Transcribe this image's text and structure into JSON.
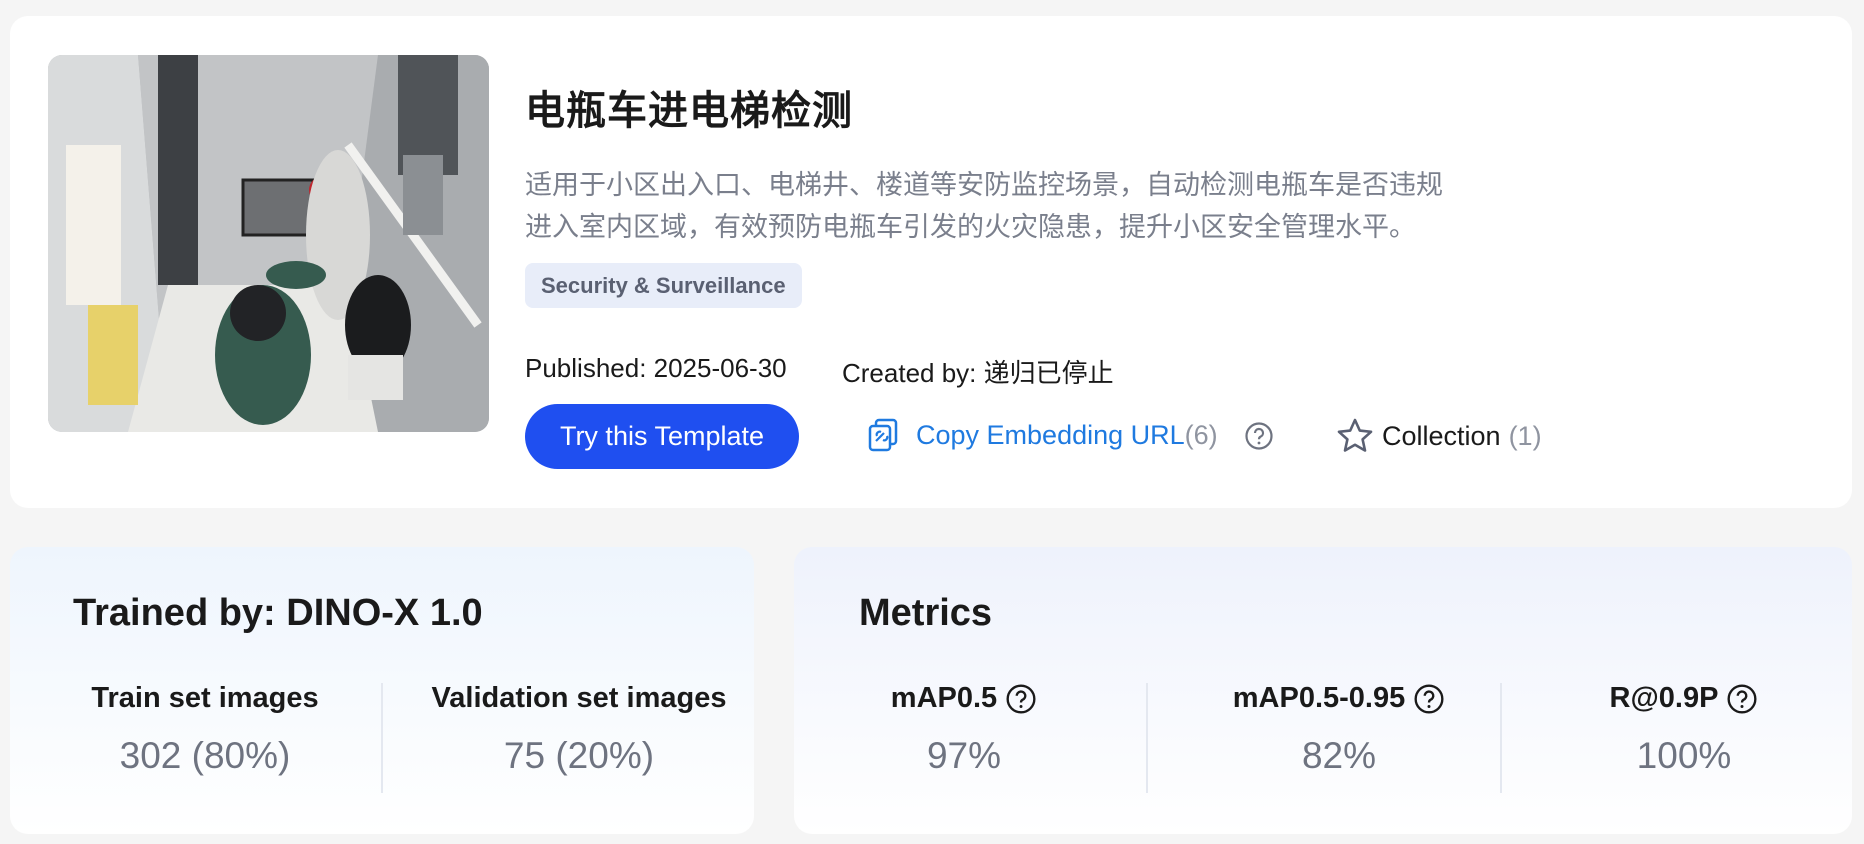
{
  "template": {
    "title": "电瓶车进电梯检测",
    "description": "适用于小区出入口、电梯井、楼道等安防监控场景，自动检测电瓶车是否违规进入室内区域，有效预防电瓶车引发的火灾隐患，提升小区安全管理水平。",
    "tag": "Security & Surveillance",
    "published": "Published: 2025-06-30",
    "created_by": "Created by: 递归已停止"
  },
  "actions": {
    "try_label": "Try this Template",
    "copy_label": "Copy Embedding URL",
    "copy_count": "(6)",
    "collection_label": "Collection",
    "collection_count": "(1)"
  },
  "training": {
    "title": "Trained by: DINO-X 1.0",
    "train_label": "Train set images",
    "train_value": "302 (80%)",
    "val_label": "Validation set images",
    "val_value": "75 (20%)"
  },
  "metrics": {
    "title": "Metrics",
    "items": [
      {
        "label": "mAP0.5",
        "value": "97%"
      },
      {
        "label": "mAP0.5-0.95",
        "value": "82%"
      },
      {
        "label": "R@0.9P",
        "value": "100%"
      }
    ]
  },
  "colors": {
    "primary": "#1f4ff0",
    "link": "#1f7ae0",
    "tag_bg": "#e8edf9"
  }
}
